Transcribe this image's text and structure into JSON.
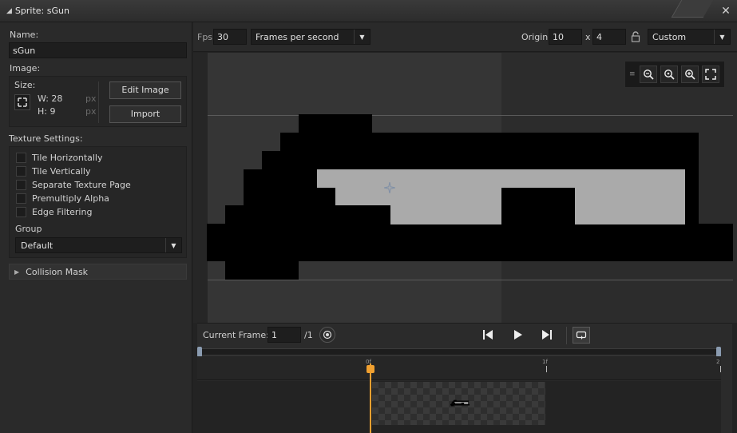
{
  "window": {
    "title": "Sprite: sGun"
  },
  "left": {
    "name_label": "Name:",
    "name_value": "sGun",
    "image_label": "Image:",
    "size_label": "Size:",
    "width_text": "W: 28",
    "height_text": "H: 9",
    "px_unit": "px",
    "edit_image_label": "Edit Image",
    "import_label": "Import",
    "texture_settings_label": "Texture Settings:",
    "checkboxes": [
      {
        "label": "Tile Horizontally",
        "checked": false
      },
      {
        "label": "Tile Vertically",
        "checked": false
      },
      {
        "label": "Separate Texture Page",
        "checked": false
      },
      {
        "label": "Premultiply Alpha",
        "checked": false
      },
      {
        "label": "Edge Filtering",
        "checked": false
      }
    ],
    "group_label": "Group",
    "group_value": "Default",
    "collision_mask_label": "Collision Mask"
  },
  "toolbar": {
    "fps_label": "Fps",
    "fps_value": "30",
    "fps_mode": "Frames per second",
    "origin_label": "Origin",
    "origin_x": "10",
    "origin_x_sep": "x",
    "origin_y": "4",
    "origin_mode": "Custom"
  },
  "frames": {
    "current_frame_label": "Current Frame:",
    "current_frame_value": "1",
    "total_frames": "/1",
    "ruler_marks": [
      "0f",
      "1f",
      "2"
    ]
  },
  "colors": {
    "accent": "#f0a030",
    "sprite_gray": "#aaaaaa",
    "sprite_black": "#000000"
  },
  "icons": {
    "title": "sprite-icon",
    "close": "close-icon",
    "size_fit": "fit-size-icon",
    "lock": "lock-icon",
    "zoom_out": "zoom-out-icon",
    "zoom_reset": "zoom-reset-icon",
    "zoom_in": "zoom-in-icon",
    "fullscreen": "fullscreen-icon",
    "onion": "onion-skin-icon",
    "first": "skip-back-icon",
    "play": "play-icon",
    "last": "skip-forward-icon",
    "loop": "loop-icon"
  }
}
